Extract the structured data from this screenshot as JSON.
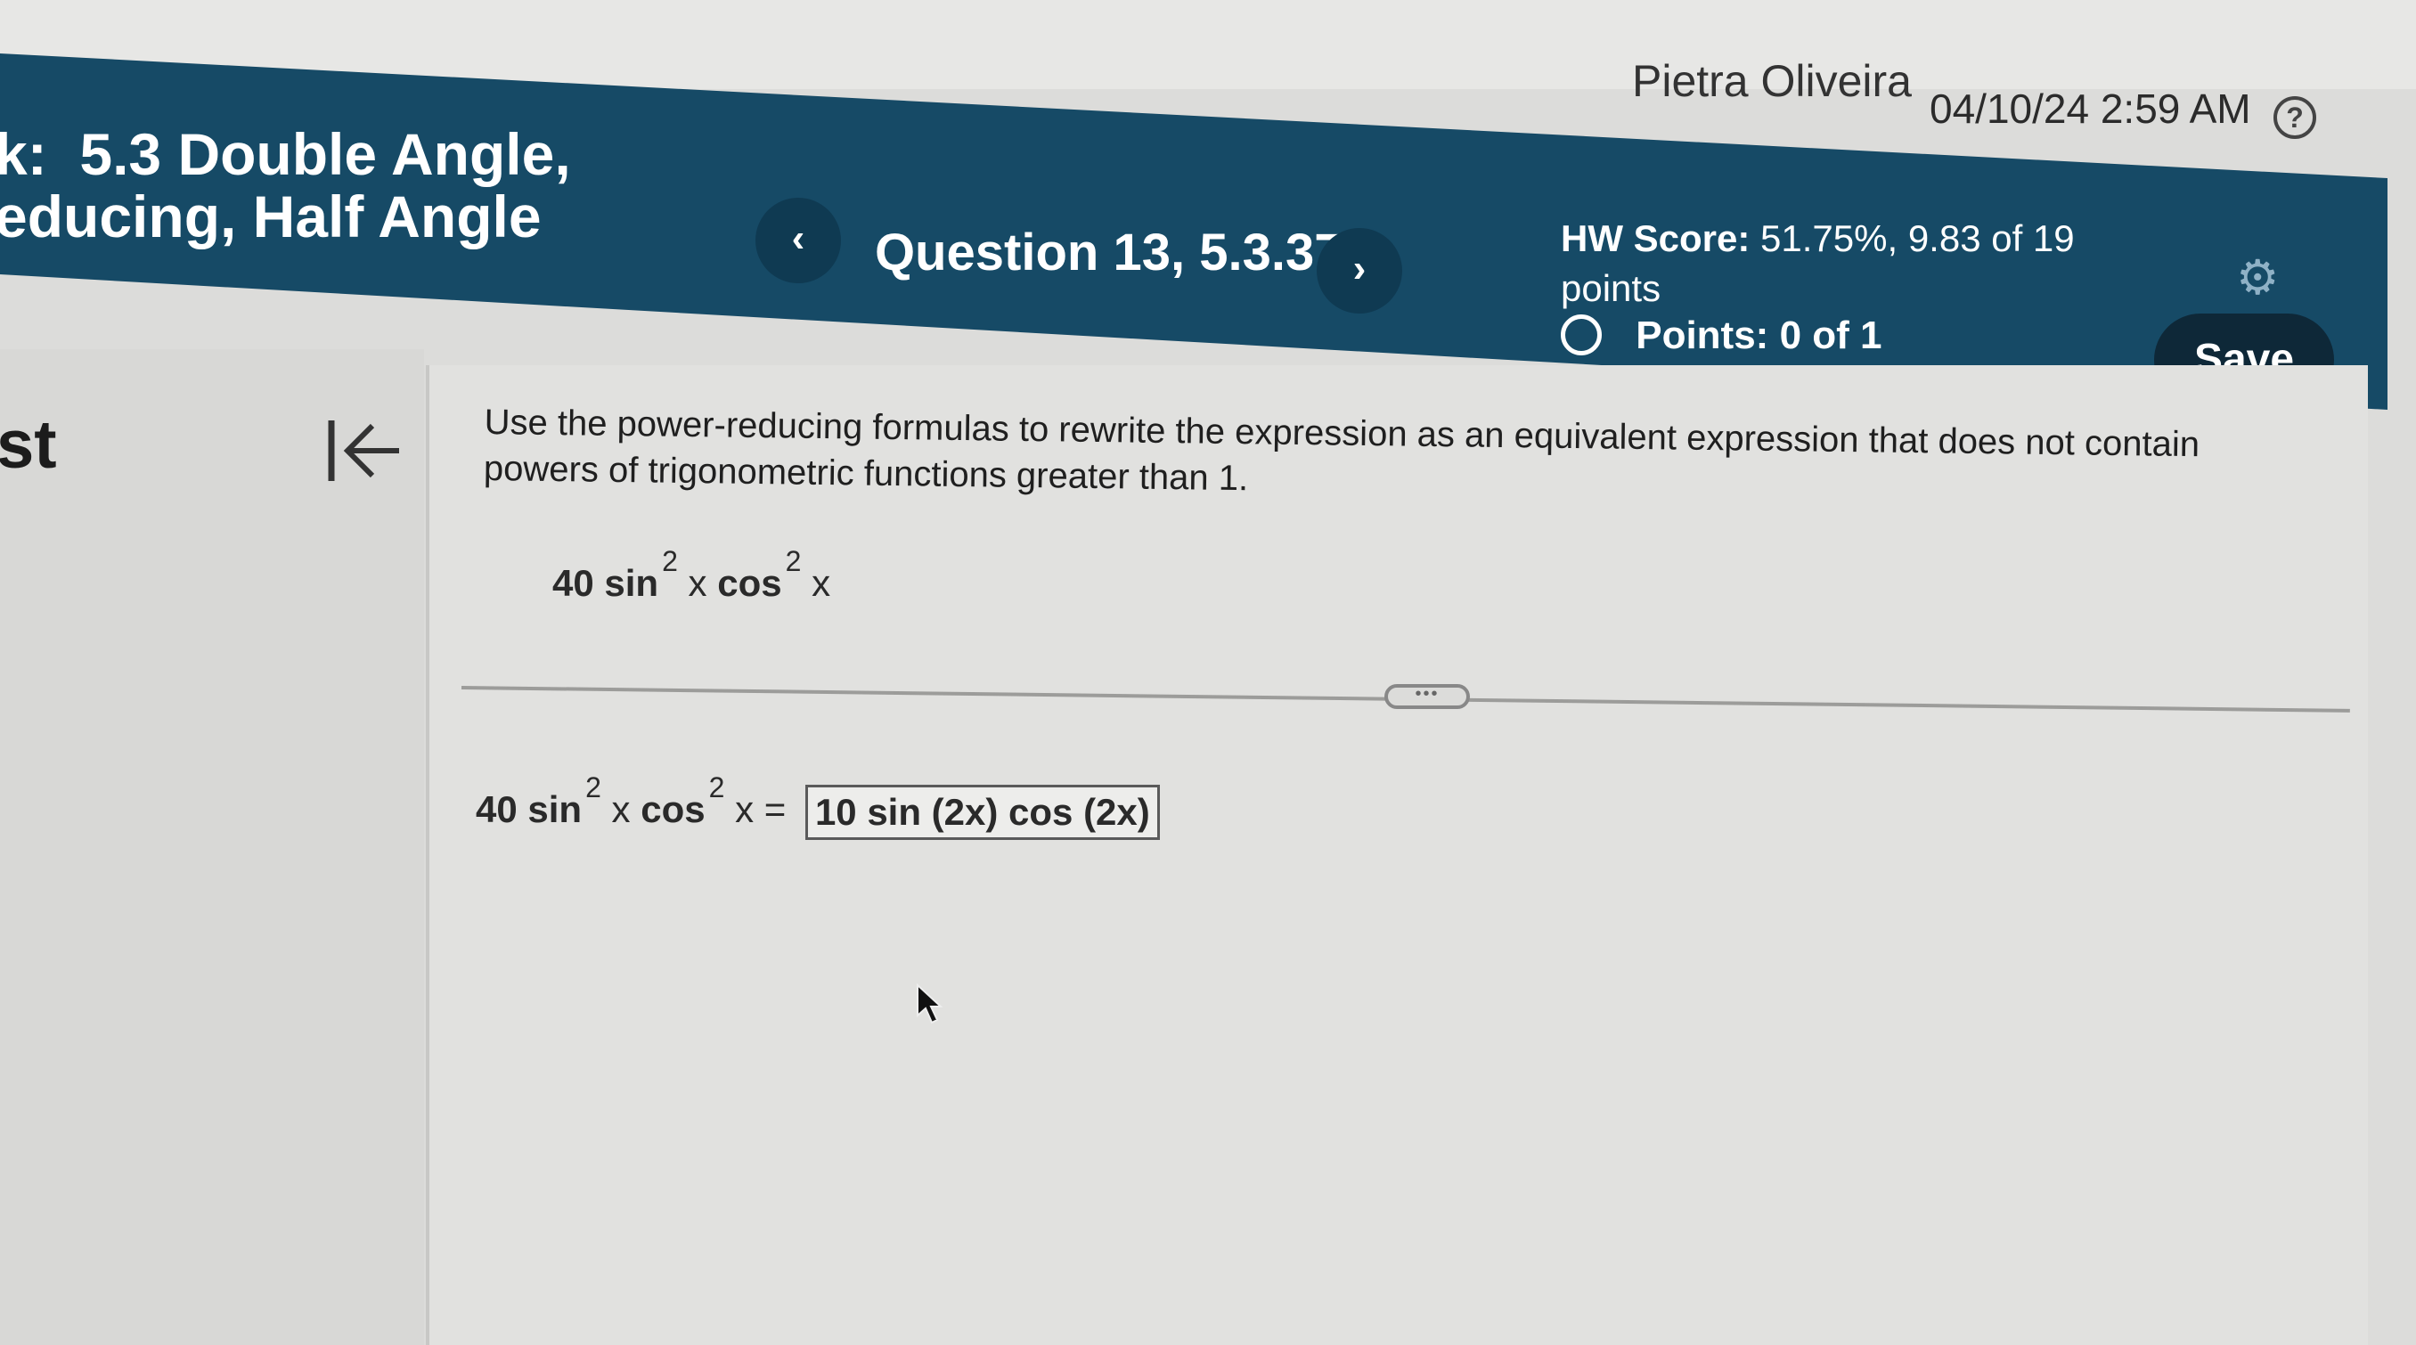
{
  "top_bar": {
    "user_name": "Pietra Oliveira",
    "datetime": "04/10/24 2:59 AM",
    "help_icon": "help-circle-icon"
  },
  "header": {
    "assignment_title": "k:  5.3 Double Angle,\neducing, Half Angle",
    "prev_label": "‹",
    "question_label": "Question 13, 5.3.37",
    "next_label": "›",
    "hw_score_label": "HW Score:",
    "hw_score_value": "51.75%, 9.83 of 19",
    "hw_score_unit": "points",
    "points_label": "Points:",
    "points_value": "0 of 1",
    "settings_icon": "gear-icon",
    "save_label": "Save",
    "colors": {
      "header_bg": "#164a66",
      "save_bg": "#0e2838"
    }
  },
  "sidebar": {
    "label": "st",
    "collapse_icon": "collapse-left-icon"
  },
  "question": {
    "prompt": "Use the power-reducing formulas to rewrite the expression as an equivalent expression that does not contain powers of trigonometric functions greater than 1.",
    "expression": {
      "coef": "40",
      "f1": "sin",
      "exp1": "2",
      "var1": "x",
      "f2": "cos",
      "exp2": "2",
      "var2": "x"
    },
    "answer": {
      "lhs_coef": "40",
      "lhs_f1": "sin",
      "lhs_exp1": "2",
      "lhs_var1": "x",
      "lhs_f2": "cos",
      "lhs_exp2": "2",
      "lhs_var2": "x",
      "equals": "=",
      "value": "10 sin (2x) cos (2x)"
    },
    "divider_handle": "•••"
  }
}
